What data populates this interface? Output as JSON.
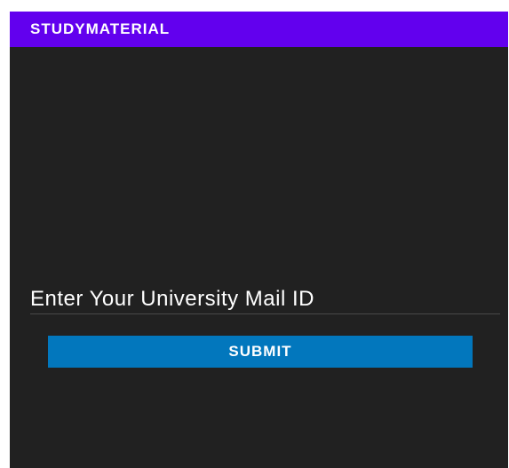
{
  "app_bar": {
    "title": "STUDYMATERIAL"
  },
  "form": {
    "email_field": {
      "value": "Enter Your University Mail ID"
    },
    "submit_label": "SUBMIT"
  },
  "colors": {
    "app_bar": "#6200ee",
    "background": "#212121",
    "button": "#0277bd",
    "text": "#ffffff"
  }
}
